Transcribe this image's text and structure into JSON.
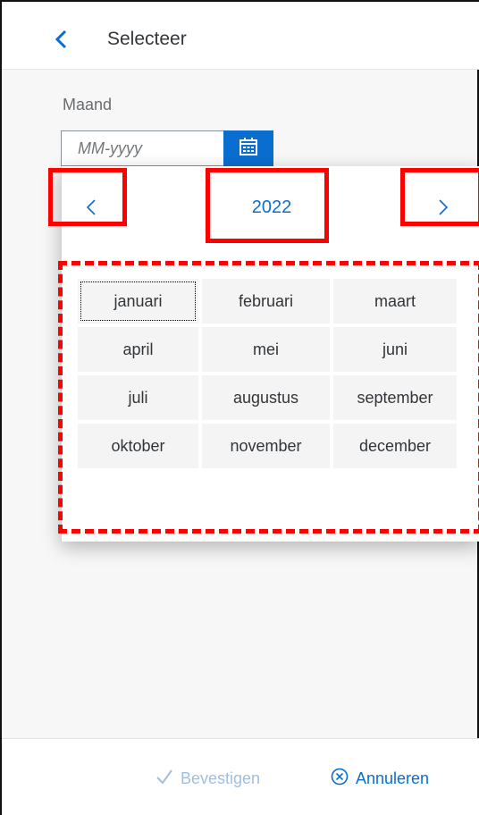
{
  "header": {
    "title": "Selecteer",
    "back_icon": "chevron-left-icon"
  },
  "field": {
    "label": "Maand",
    "placeholder": "MM-yyyy",
    "value": "",
    "calendar_icon": "calendar-icon"
  },
  "picker": {
    "year": "2022",
    "prev_icon": "chevron-left-icon",
    "next_icon": "chevron-right-icon",
    "months": [
      "januari",
      "februari",
      "maart",
      "april",
      "mei",
      "juni",
      "juli",
      "augustus",
      "september",
      "oktober",
      "november",
      "december"
    ],
    "focused_month": "januari"
  },
  "footer": {
    "confirm_label": "Bevestigen",
    "confirm_icon": "checkmark-icon",
    "cancel_label": "Annuleren",
    "cancel_icon": "circle-x-icon"
  },
  "colors": {
    "accent": "#0a6ed1",
    "highlight": "#ff0000",
    "disabled_text": "#9fbfe2"
  }
}
